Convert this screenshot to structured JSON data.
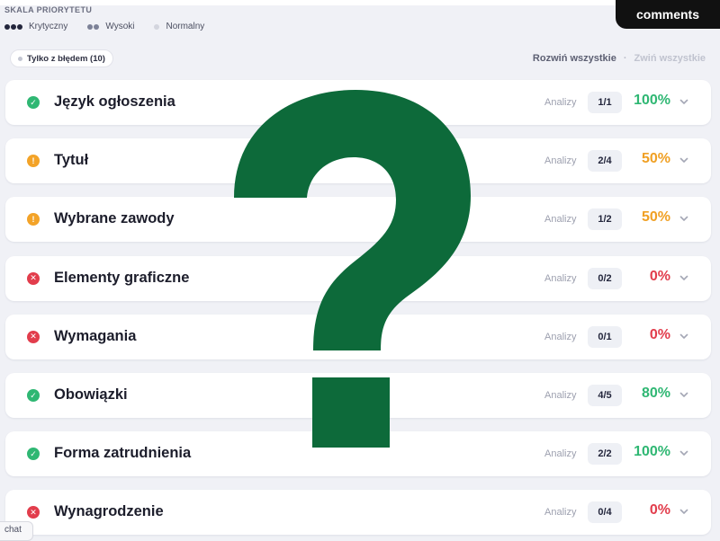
{
  "legend": {
    "title": "SKALA PRIORYTETU",
    "items": [
      {
        "label": "Krytyczny",
        "level": "critical"
      },
      {
        "label": "Wysoki",
        "level": "high"
      },
      {
        "label": "Normalny",
        "level": "normal"
      }
    ]
  },
  "header": {
    "comments_label": "comments"
  },
  "filter": {
    "chip_label": "Tylko z błędem (10)"
  },
  "controls": {
    "expand_all": "Rozwiń wszystkie",
    "separator": "·",
    "collapse_all": "Zwiń wszystkie"
  },
  "rows": [
    {
      "title": "Język ogłoszenia",
      "analyses_label": "Analizy",
      "score": "1/1",
      "percent": "100%",
      "status": "ok"
    },
    {
      "title": "Tytuł",
      "analyses_label": "Analizy",
      "score": "2/4",
      "percent": "50%",
      "status": "warn"
    },
    {
      "title": "Wybrane zawody",
      "analyses_label": "Analizy",
      "score": "1/2",
      "percent": "50%",
      "status": "warn"
    },
    {
      "title": "Elementy graficzne",
      "analyses_label": "Analizy",
      "score": "0/2",
      "percent": "0%",
      "status": "error"
    },
    {
      "title": "Wymagania",
      "analyses_label": "Analizy",
      "score": "0/1",
      "percent": "0%",
      "status": "error"
    },
    {
      "title": "Obowiązki",
      "analyses_label": "Analizy",
      "score": "4/5",
      "percent": "80%",
      "status": "ok"
    },
    {
      "title": "Forma zatrudnienia",
      "analyses_label": "Analizy",
      "score": "2/2",
      "percent": "100%",
      "status": "ok"
    },
    {
      "title": "Wynagrodzenie",
      "analyses_label": "Analizy",
      "score": "0/4",
      "percent": "0%",
      "status": "error"
    }
  ],
  "chat": {
    "label": "chat"
  },
  "overlay": {
    "icon": "question-mark",
    "color": "#0d6a3a"
  },
  "colors": {
    "ok": "#2fb773",
    "warn": "#f3a328",
    "error": "#e23d4c"
  }
}
